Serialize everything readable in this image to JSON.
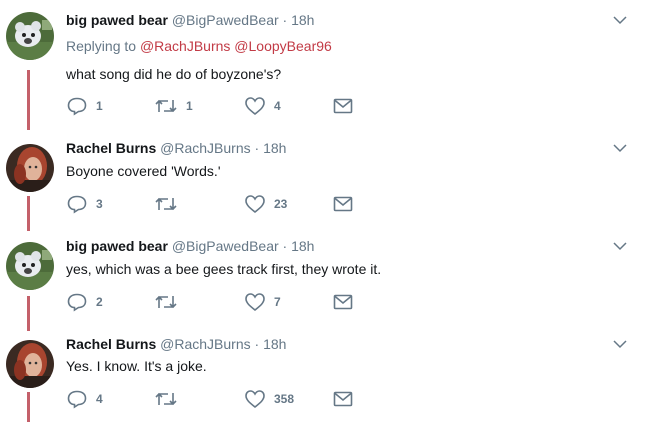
{
  "tweets": [
    {
      "name": "big pawed bear",
      "handle": "@BigPawedBear",
      "dot": "·",
      "time": "18h",
      "reply_prefix": "Replying to",
      "mentions": [
        "@RachJBurns",
        "@LoopyBear96"
      ],
      "text": "what song did he do of boyzone's?",
      "replies": "1",
      "retweets": "1",
      "likes": "4",
      "avatar": "bear-avatar"
    },
    {
      "name": "Rachel Burns",
      "handle": "@RachJBurns",
      "dot": "·",
      "time": "18h",
      "text": "Boyone covered 'Words.'",
      "replies": "3",
      "retweets": "",
      "likes": "23",
      "avatar": "rachel-avatar"
    },
    {
      "name": "big pawed bear",
      "handle": "@BigPawedBear",
      "dot": "·",
      "time": "18h",
      "text": "yes, which was a bee gees track first, they wrote it.",
      "replies": "2",
      "retweets": "",
      "likes": "7",
      "avatar": "bear-avatar"
    },
    {
      "name": "Rachel Burns",
      "handle": "@RachJBurns",
      "dot": "·",
      "time": "18h",
      "text": "Yes. I know. It's a joke.",
      "replies": "4",
      "retweets": "",
      "likes": "358",
      "avatar": "rachel-avatar"
    }
  ],
  "colors": {
    "thread_line": "#c4606a",
    "mention": "#c23b46",
    "muted": "#657786",
    "text": "#14171a"
  },
  "icons": [
    "chevron-down-icon",
    "reply-icon",
    "retweet-icon",
    "like-icon",
    "message-icon"
  ]
}
